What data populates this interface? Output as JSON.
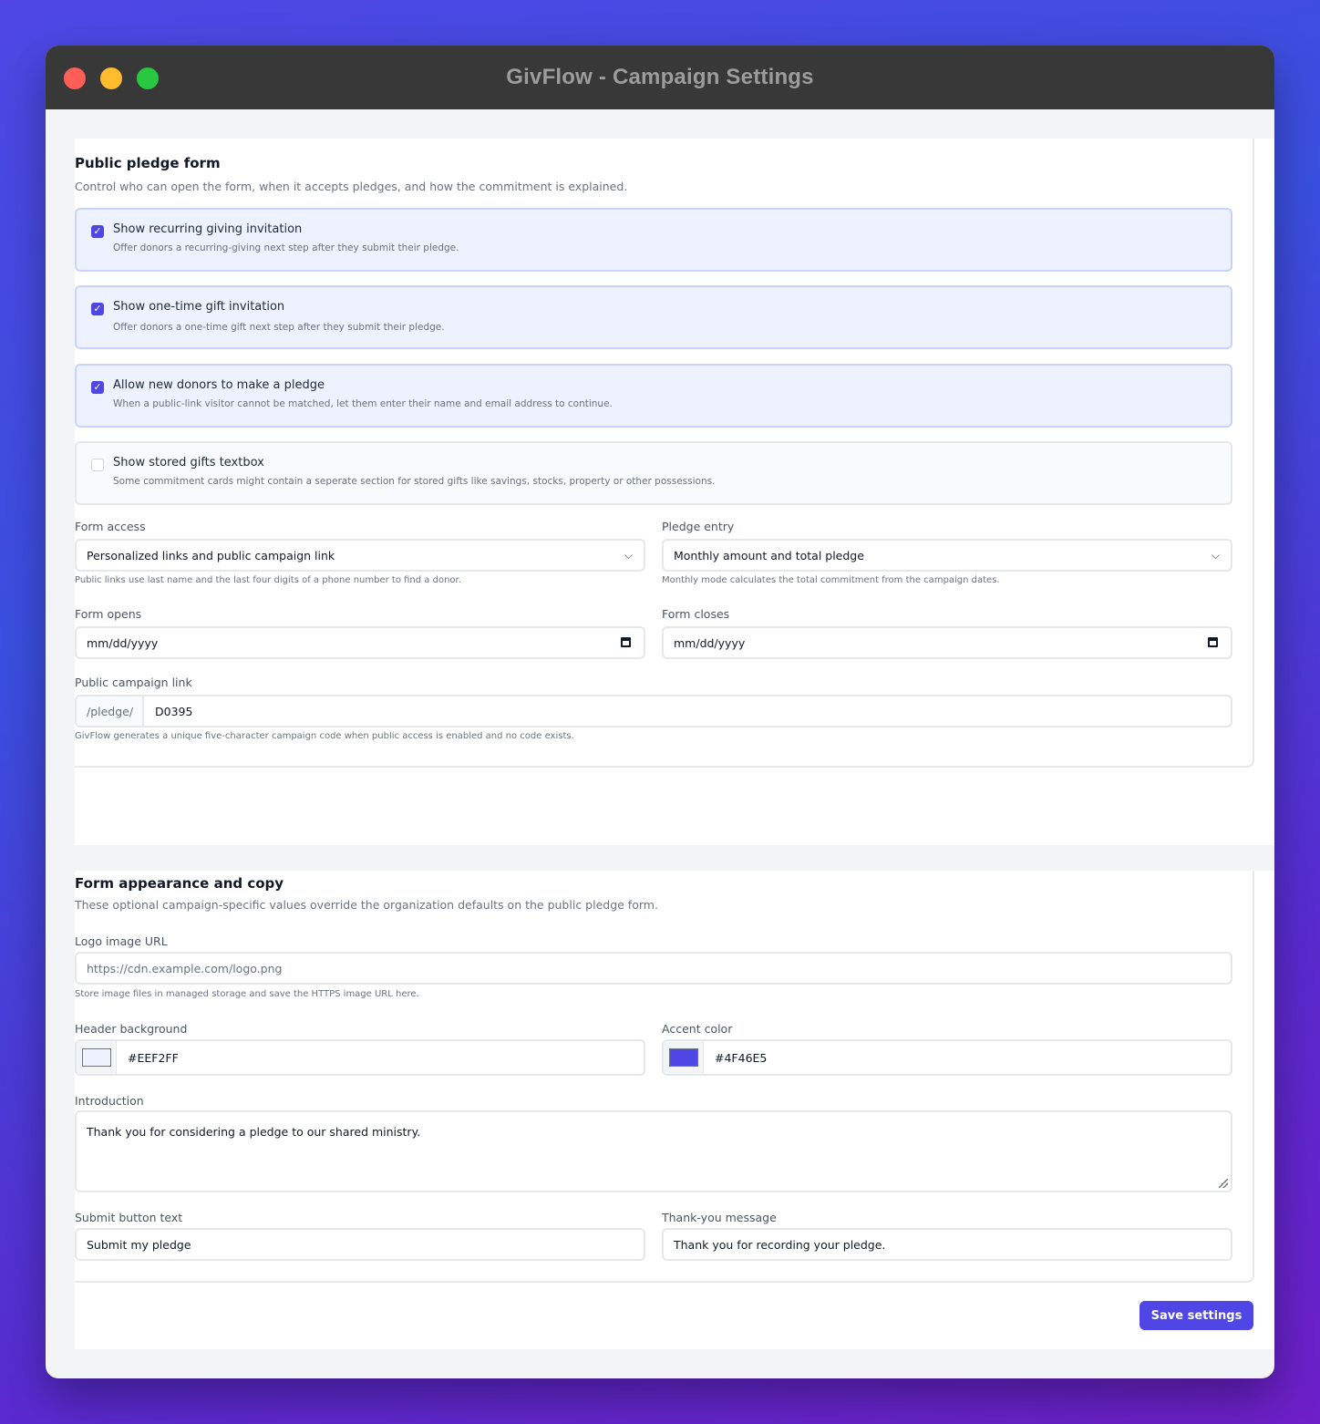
{
  "window": {
    "title": "GivFlow - Campaign Settings"
  },
  "public_form": {
    "heading": "Public pledge form",
    "subtitle": "Control who can open the form, when it accepts pledges, and how the commitment is explained.",
    "options": [
      {
        "label": "Show recurring giving invitation",
        "description": "Offer donors a recurring-giving next step after they submit their pledge.",
        "checked": true
      },
      {
        "label": "Show one-time gift invitation",
        "description": "Offer donors a one-time gift next step after they submit their pledge.",
        "checked": true
      },
      {
        "label": "Allow new donors to make a pledge",
        "description": "When a public-link visitor cannot be matched, let them enter their name and email address to continue.",
        "checked": true
      },
      {
        "label": "Show stored gifts textbox",
        "description": "Some commitment cards might contain a seperate section for stored gifts like savings, stocks, property or other possessions.",
        "checked": false
      }
    ],
    "form_access": {
      "label": "Form access",
      "value": "Personalized links and public campaign link",
      "hint": "Public links use last name and the last four digits of a phone number to find a donor."
    },
    "pledge_entry": {
      "label": "Pledge entry",
      "value": "Monthly amount and total pledge",
      "hint": "Monthly mode calculates the total commitment from the campaign dates."
    },
    "form_opens": {
      "label": "Form opens",
      "value": "mm/dd/yyyy"
    },
    "form_closes": {
      "label": "Form closes",
      "value": "mm/dd/yyyy"
    },
    "public_link": {
      "label": "Public campaign link",
      "prefix": "/pledge/",
      "value": "D0395",
      "hint": "GivFlow generates a unique five-character campaign code when public access is enabled and no code exists."
    }
  },
  "appearance": {
    "heading": "Form appearance and copy",
    "subtitle": "These optional campaign-specific values override the organization defaults on the public pledge form.",
    "logo": {
      "label": "Logo image URL",
      "placeholder": "https://cdn.example.com/logo.png",
      "hint": "Store image files in managed storage and save the HTTPS image URL here."
    },
    "header_background": {
      "label": "Header background",
      "value": "#EEF2FF"
    },
    "accent_color": {
      "label": "Accent color",
      "value": "#4F46E5"
    },
    "introduction": {
      "label": "Introduction",
      "value": "Thank you for considering a pledge to our shared ministry."
    },
    "submit_text": {
      "label": "Submit button text",
      "value": "Submit my pledge"
    },
    "thank_you": {
      "label": "Thank-you message",
      "value": "Thank you for recording your pledge."
    }
  },
  "actions": {
    "save_label": "Save settings"
  },
  "icons": {
    "checkbox_checked": "check-icon",
    "select": "chevron-down-icon",
    "date": "calendar-icon",
    "resize": "resize-grip-icon"
  }
}
